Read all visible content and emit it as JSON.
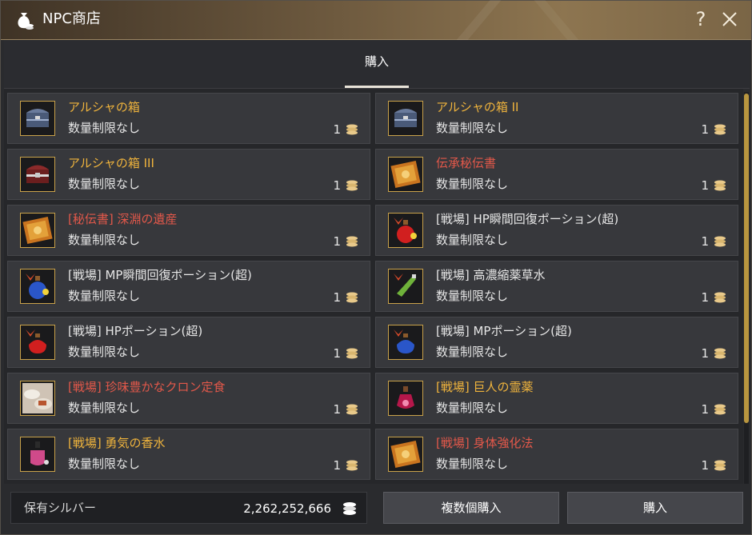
{
  "window": {
    "title": "NPC商店",
    "help_label": "?"
  },
  "tabs": [
    {
      "label": "購入",
      "active": true
    }
  ],
  "items": [
    {
      "name": "アルシャの箱",
      "limit": "数量制限なし",
      "qty": "1",
      "color": "yellow",
      "icon": "chest-blue-icon"
    },
    {
      "name": "アルシャの箱 II",
      "limit": "数量制限なし",
      "qty": "1",
      "color": "yellow",
      "icon": "chest-blue-icon"
    },
    {
      "name": "アルシャの箱 III",
      "limit": "数量制限なし",
      "qty": "1",
      "color": "yellow",
      "icon": "chest-red-icon"
    },
    {
      "name": "伝承秘伝書",
      "limit": "数量制限なし",
      "qty": "1",
      "color": "red",
      "icon": "tome-icon"
    },
    {
      "name": "[秘伝書] 深淵の遺産",
      "limit": "数量制限なし",
      "qty": "1",
      "color": "red",
      "icon": "tome-icon"
    },
    {
      "name": "[戦場] HP瞬間回復ポーション(超)",
      "limit": "数量制限なし",
      "qty": "1",
      "color": "white",
      "icon": "hp-potion-icon"
    },
    {
      "name": "[戦場] MP瞬間回復ポーション(超)",
      "limit": "数量制限なし",
      "qty": "1",
      "color": "white",
      "icon": "mp-potion-icon"
    },
    {
      "name": "[戦場] 高濃縮薬草水",
      "limit": "数量制限なし",
      "qty": "1",
      "color": "white",
      "icon": "herb-potion-icon"
    },
    {
      "name": "[戦場] HPポーション(超)",
      "limit": "数量制限なし",
      "qty": "1",
      "color": "white",
      "icon": "hp-flask-icon"
    },
    {
      "name": "[戦場] MPポーション(超)",
      "limit": "数量制限なし",
      "qty": "1",
      "color": "white",
      "icon": "mp-flask-icon"
    },
    {
      "name": "[戦場] 珍味豊かなクロン定食",
      "limit": "数量制限なし",
      "qty": "1",
      "color": "red",
      "icon": "meal-icon"
    },
    {
      "name": "[戦場] 巨人の霊薬",
      "limit": "数量制限なし",
      "qty": "1",
      "color": "yellow",
      "icon": "elixir-icon"
    },
    {
      "name": "[戦場] 勇気の香水",
      "limit": "数量制限なし",
      "qty": "1",
      "color": "yellow",
      "icon": "perfume-icon"
    },
    {
      "name": "[戦場] 身体強化法",
      "limit": "数量制限なし",
      "qty": "1",
      "color": "red",
      "icon": "tome-icon"
    }
  ],
  "footer": {
    "silver_label": "保有シルバー",
    "silver_value": "2,262,252,666",
    "multi_buy_label": "複数個購入",
    "buy_label": "購入"
  },
  "colors": {
    "yellow": "#f0b43c",
    "red": "#e2584a",
    "white": "#e6e6e6",
    "accent_gold": "#c9a24a"
  }
}
